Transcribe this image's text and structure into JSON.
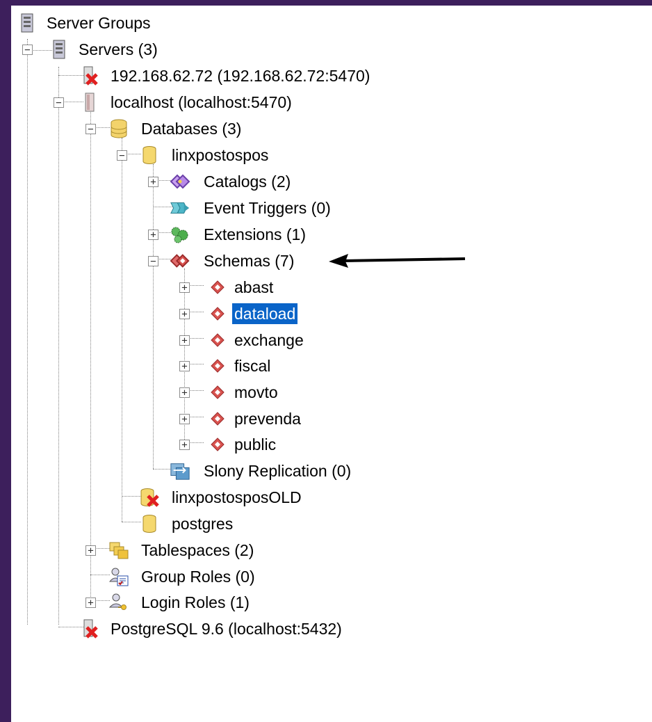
{
  "tree": {
    "server_groups": "Server Groups",
    "servers": "Servers (3)",
    "server_remote": "192.168.62.72 (192.168.62.72:5470)",
    "server_localhost": "localhost (localhost:5470)",
    "databases": "Databases (3)",
    "db_linx": "linxpostospos",
    "catalogs": "Catalogs (2)",
    "event_triggers": "Event Triggers (0)",
    "extensions": "Extensions (1)",
    "schemas": "Schemas (7)",
    "schema_items": [
      "abast",
      "dataload",
      "exchange",
      "fiscal",
      "movto",
      "prevenda",
      "public"
    ],
    "slony": "Slony Replication (0)",
    "db_old": "linxpostosposOLD",
    "db_postgres": "postgres",
    "tablespaces": "Tablespaces (2)",
    "group_roles": "Group Roles (0)",
    "login_roles": "Login Roles (1)",
    "server_pg96": "PostgreSQL 9.6 (localhost:5432)"
  },
  "selected_item": "dataload",
  "colors": {
    "background": "#3d1f5c",
    "selection": "#0a64c8",
    "schema_icon": "#d9534f",
    "error_icon": "#e02020"
  }
}
